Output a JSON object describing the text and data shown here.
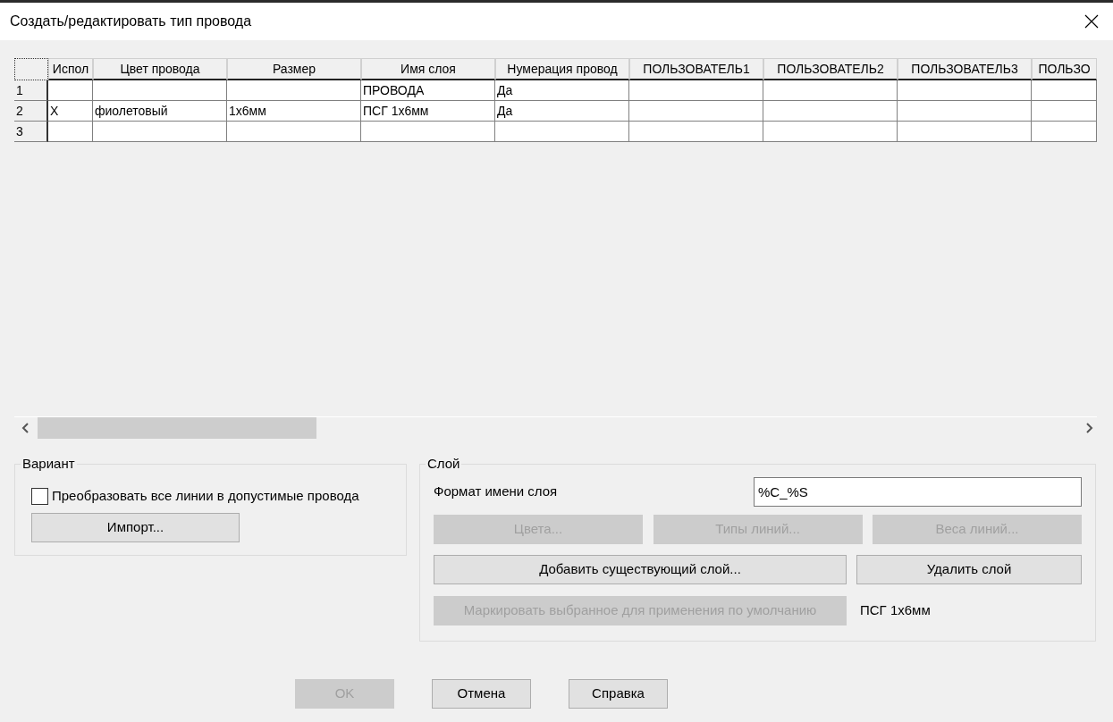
{
  "window": {
    "title": "Создать/редактировать тип провода"
  },
  "table": {
    "columns": [
      "Испол",
      "Цвет провода",
      "Размер",
      "Имя слоя",
      "Нумерация провод",
      "ПОЛЬЗОВАТЕЛЬ1",
      "ПОЛЬЗОВАТЕЛЬ2",
      "ПОЛЬЗОВАТЕЛЬ3",
      "ПОЛЬЗО"
    ],
    "rows": [
      {
        "number": "1",
        "cells": [
          null,
          null,
          null,
          "ПРОВОДА",
          "Да",
          null,
          null,
          null,
          null
        ]
      },
      {
        "number": "2",
        "cells": [
          "X",
          "фиолетовый",
          "1x6мм",
          "ПСГ 1x6мм",
          "Да",
          null,
          null,
          null,
          null
        ]
      },
      {
        "number": "3",
        "cells": [
          null,
          null,
          null,
          null,
          null,
          null,
          null,
          null,
          null
        ]
      }
    ]
  },
  "variant": {
    "title": "Вариант",
    "checkbox": {
      "label": "Преобразовать все линии в допустимые провода",
      "checked": false
    },
    "import_button": {
      "label": "Импорт...",
      "disabled": false
    }
  },
  "layer": {
    "title": "Слой",
    "format_label": "Формат имени слоя",
    "format_value": "%C_%S",
    "buttons": [
      {
        "label": "Цвета...",
        "disabled": true
      },
      {
        "label": "Типы линий...",
        "disabled": true
      },
      {
        "label": "Веса линий...",
        "disabled": true
      }
    ],
    "add_button": {
      "label": "Добавить существующий слой...",
      "disabled": false
    },
    "delete_button": {
      "label": "Удалить слой",
      "disabled": false
    },
    "mark_button": {
      "label": "Маркировать выбранное для применения по умолчанию",
      "disabled": true
    },
    "default_layer": "ПСГ 1x6мм"
  },
  "footer_buttons": [
    {
      "label": "OK",
      "disabled": true
    },
    {
      "label": "Отмена",
      "disabled": false
    },
    {
      "label": "Справка",
      "disabled": false
    }
  ]
}
